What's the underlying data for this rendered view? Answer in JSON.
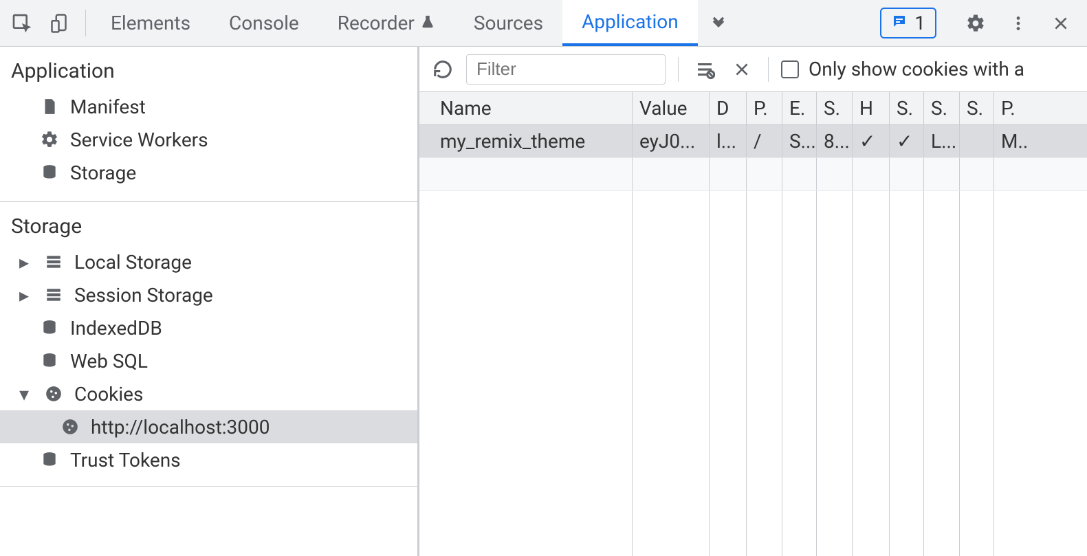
{
  "toolbar": {
    "tabs": {
      "elements": "Elements",
      "console": "Console",
      "recorder": "Recorder",
      "sources": "Sources",
      "application": "Application"
    },
    "issues_count": "1"
  },
  "sidebar": {
    "sections": {
      "application_title": "Application",
      "storage_title": "Storage"
    },
    "application_items": {
      "manifest": "Manifest",
      "service_workers": "Service Workers",
      "storage": "Storage"
    },
    "storage_items": {
      "local_storage": "Local Storage",
      "session_storage": "Session Storage",
      "indexeddb": "IndexedDB",
      "websql": "Web SQL",
      "cookies": "Cookies",
      "cookie_origin": "http://localhost:3000",
      "trust_tokens": "Trust Tokens"
    }
  },
  "filterbar": {
    "placeholder": "Filter",
    "only_show_label": "Only show cookies with a"
  },
  "cookies_table": {
    "headers": {
      "name": "Name",
      "value": "Value",
      "d": "D",
      "p": "P.",
      "e": "E.",
      "s1": "S.",
      "h": "H",
      "s2": "S.",
      "s3": "S.",
      "s4": "S.",
      "p2": "P."
    },
    "rows": [
      {
        "name": "my_remix_theme",
        "value": "eyJ0...",
        "d": "l...",
        "p": "/",
        "e": "S...",
        "s1": "8...",
        "h": "✓",
        "s2": "✓",
        "s3": "L...",
        "s4": "",
        "p2": "M.."
      }
    ]
  }
}
